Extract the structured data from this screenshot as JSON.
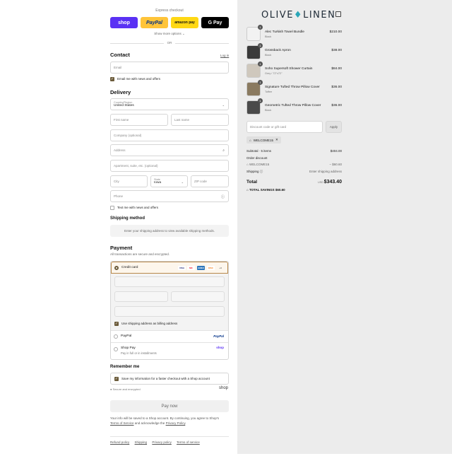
{
  "express": {
    "title": "Express checkout",
    "shop_label": "shop",
    "paypal_label": "PayPal",
    "amazon_label": "amazon pay",
    "gpay_label": "G Pay",
    "show_more": "Show more options ⌄",
    "or": "OR"
  },
  "contact": {
    "heading": "Contact",
    "login": "Log in",
    "email_placeholder": "Email",
    "news_label": "Email me with news and offers"
  },
  "delivery": {
    "heading": "Delivery",
    "country_label": "Country/Region",
    "country_value": "United States",
    "first_name": "First name",
    "last_name": "Last name",
    "company": "Company (optional)",
    "address": "Address",
    "apartment": "Apartment, suite, etc. (optional)",
    "city": "City",
    "state_label": "State",
    "state_value": "Iowa",
    "zip": "ZIP code",
    "phone": "Phone",
    "text_label": "Text me with news and offers"
  },
  "shipping": {
    "heading": "Shipping method",
    "info": "Enter your shipping address to view available shipping methods."
  },
  "payment": {
    "heading": "Payment",
    "sub": "All transactions are secure and encrypted.",
    "credit_card": "Credit card",
    "cards": [
      "VISA",
      "MC",
      "AMEX",
      "DISC",
      "+4"
    ],
    "billing_label": "Use shipping address as billing address",
    "paypal": "PayPal",
    "paypal_brand": "PayPal",
    "shop_pay": "Shop Pay",
    "shop_pay_sub": "Pay in full or in installments",
    "shop_brand": "shop"
  },
  "remember": {
    "heading": "Remember me",
    "save_label": "Save my information for a faster checkout with a Shop account",
    "secure": "Secure and encrypted",
    "shop_mark": "shop"
  },
  "pay_now": "Pay now",
  "legal": {
    "text": "Your info will be saved to a Shop account. By continuing, you agree to Shop's",
    "terms": "Terms of Service",
    "and": "and acknowledge the",
    "privacy": "Privacy Policy",
    "end": "."
  },
  "footer": [
    "Refund policy",
    "Shipping",
    "Privacy policy",
    "Terms of service"
  ],
  "brand": {
    "part1": "OLIVE",
    "drop": "♦",
    "part2": "LINEN"
  },
  "cart": {
    "items": [
      {
        "name": "Alec Turkish Towel Bundle",
        "variant": "Black",
        "price": "$210.00",
        "qty": "1"
      },
      {
        "name": "Grossback Apron",
        "variant": "Black",
        "price": "$38.00",
        "qty": "1"
      },
      {
        "name": "Soho Supersoft Shower Curtain",
        "variant": "Grey / 72\"x72\"",
        "price": "$84.00",
        "qty": "1"
      },
      {
        "name": "Signature Tufted Throw Pillow Cover",
        "variant": "Toffee",
        "price": "$36.00",
        "qty": "1"
      },
      {
        "name": "Geometric Tufted Throw Pillow Cover",
        "variant": "Black",
        "price": "$36.00",
        "qty": "1"
      }
    ],
    "discount_placeholder": "Discount code or gift card",
    "apply": "Apply",
    "code_tag": "WELCOME15",
    "subtotal_label": "Subtotal · 5 items",
    "subtotal_value": "$404.00",
    "order_discount": "Order discount",
    "code_line": "WELCOME15",
    "discount_value": "− $60.60",
    "shipping_label": "Shipping ⓘ",
    "shipping_value": "Enter shipping address",
    "total_label": "Total",
    "currency": "USD",
    "total_value": "$343.40",
    "savings_label": "TOTAL SAVINGS",
    "savings_value": "$60.60"
  }
}
